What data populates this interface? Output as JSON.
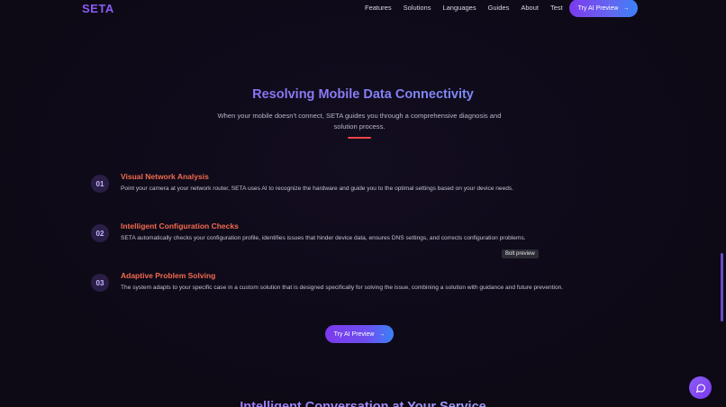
{
  "nav": {
    "logo": "SETA",
    "links": [
      "Features",
      "Solutions",
      "Languages",
      "Guides",
      "About",
      "Test"
    ],
    "cta_label": "Try AI Preview",
    "cta_icon": "arrow-right-icon"
  },
  "hero": {
    "title": "Resolving Mobile Data Connectivity",
    "description": "When your mobile doesn't connect, SETA guides you through a comprehensive diagnosis and solution process."
  },
  "steps": [
    {
      "number": "01",
      "title": "Visual Network Analysis",
      "text": "Point your camera at your network router, SETA uses AI to recognize the hardware and guide you to the optimal settings based on your device needs."
    },
    {
      "number": "02",
      "title": "Intelligent Configuration Checks",
      "text": "SETA automatically checks your configuration profile, identifies issues that hinder device data, ensures DNS settings, and corrects configuration problems."
    },
    {
      "number": "03",
      "title": "Adaptive Problem Solving",
      "text": "The system adapts to your specific case in a custom solution that is designed specifically for solving the issue, combining a solution with guidance and future prevention."
    }
  ],
  "tooltip": "Bolt preview",
  "main_cta_label": "Try AI Preview",
  "next_section_title": "Intelligent Conversation at Your Service",
  "colors": {
    "accent": "#8b5cf6",
    "step_title": "#f26b4f",
    "divider": "#ef4444",
    "background": "#0e0a17"
  },
  "icons": {
    "chat": "chat-bubble-icon",
    "arrow": "arrow-right-icon"
  }
}
